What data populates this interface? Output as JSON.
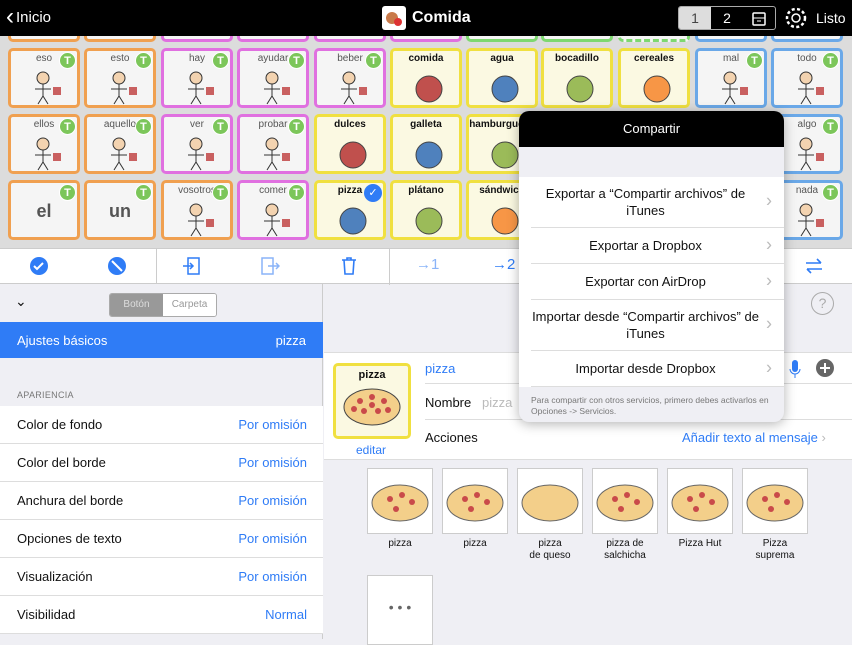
{
  "topbar": {
    "back": "Inicio",
    "title": "Comida",
    "pages": [
      "1",
      "2"
    ],
    "done": "Listo"
  },
  "colors": {
    "orange": "#f0a050",
    "pink": "#e070e0",
    "yellow": "#f0e040",
    "blue": "#6aa8e8",
    "green": "#7ed870",
    "accent": "#2f7cf6"
  },
  "grid": {
    "top_row": [
      "orange",
      "orange",
      "pink",
      "pink",
      "pink",
      "pink",
      "green",
      "green",
      "green",
      "blue",
      "blue"
    ],
    "rows": [
      [
        {
          "label": "eso",
          "c": "orange",
          "t": true,
          "icon": "pointing-icon"
        },
        {
          "label": "esto",
          "c": "orange",
          "t": true,
          "icon": "person-pointing-icon"
        },
        {
          "label": "hay",
          "c": "pink",
          "t": true,
          "icon": "shapes-icon"
        },
        {
          "label": "ayudar",
          "c": "pink",
          "t": true,
          "icon": "helping-icon"
        },
        {
          "label": "beber",
          "c": "pink",
          "t": true,
          "icon": "person-drinking-icon"
        },
        {
          "label": "comida",
          "c": "yellow",
          "food": true,
          "icon": "food-icon"
        },
        {
          "label": "agua",
          "c": "yellow",
          "food": true,
          "icon": "water-bottle-icon"
        },
        {
          "label": "bocadillo",
          "c": "yellow",
          "food": true,
          "icon": "sandwich-icon"
        },
        {
          "label": "cereales",
          "c": "yellow",
          "food": true,
          "icon": "cereal-icon"
        },
        {
          "label": "mal",
          "c": "blue",
          "t": true,
          "icon": "person-sad-icon"
        },
        {
          "label": "todo",
          "c": "blue",
          "t": true,
          "icon": "all-icon"
        }
      ],
      [
        {
          "label": "ellos",
          "c": "orange",
          "t": true,
          "icon": "people-icon"
        },
        {
          "label": "aquello",
          "c": "orange",
          "t": true,
          "icon": "pointing-icon"
        },
        {
          "label": "ver",
          "c": "pink",
          "t": true,
          "icon": "eye-icon"
        },
        {
          "label": "probar",
          "c": "pink",
          "t": true,
          "icon": "person-tasting-icon"
        },
        {
          "label": "dulces",
          "c": "yellow",
          "food": true,
          "icon": "candy-icon"
        },
        {
          "label": "galleta",
          "c": "yellow",
          "food": true,
          "icon": "cookie-icon"
        },
        {
          "label": "hamburguesa",
          "c": "yellow",
          "food": true,
          "icon": "burger-icon"
        },
        {
          "label": "",
          "c": "yellow",
          "food": true,
          "icon": "food-icon"
        },
        {
          "label": "",
          "c": "yellow",
          "food": true,
          "icon": "food-icon"
        },
        {
          "label": "",
          "c": "blue",
          "t": true,
          "icon": "word-icon"
        },
        {
          "label": "algo",
          "c": "blue",
          "t": true,
          "icon": "glass-icon"
        }
      ],
      [
        {
          "label": "",
          "big": "el",
          "c": "orange",
          "t": true
        },
        {
          "label": "",
          "big": "un",
          "c": "orange",
          "t": true
        },
        {
          "label": "vosotros",
          "c": "orange",
          "t": true,
          "icon": "people-icon"
        },
        {
          "label": "comer",
          "c": "pink",
          "t": true,
          "icon": "person-eating-icon"
        },
        {
          "label": "pizza",
          "c": "yellow",
          "food": true,
          "checked": true,
          "icon": "pizza-icon"
        },
        {
          "label": "plátano",
          "c": "yellow",
          "food": true,
          "icon": "banana-icon"
        },
        {
          "label": "sándwich",
          "c": "yellow",
          "food": true,
          "icon": "sandwich-icon"
        },
        {
          "label": "",
          "c": "yellow",
          "food": true,
          "icon": "food-icon"
        },
        {
          "label": "",
          "c": "yellow",
          "food": true,
          "icon": "food-icon"
        },
        {
          "label": "",
          "c": "blue",
          "t": true,
          "icon": "word-icon"
        },
        {
          "label": "nada",
          "c": "blue",
          "t": true,
          "icon": "nothing-icon"
        }
      ]
    ]
  },
  "toolbar": {
    "goto1": "→1",
    "goto2": "→2"
  },
  "left": {
    "seg": [
      "Botón",
      "Carpeta"
    ],
    "basic_label": "Ajustes básicos",
    "basic_value": "pizza",
    "section": "APARIENCIA",
    "rows": [
      {
        "label": "Color de fondo",
        "value": "Por omisión"
      },
      {
        "label": "Color del borde",
        "value": "Por omisión"
      },
      {
        "label": "Anchura del borde",
        "value": "Por omisión"
      },
      {
        "label": "Opciones de texto",
        "value": "Por omisión"
      },
      {
        "label": "Visualización",
        "value": "Por omisión"
      },
      {
        "label": "Visibilidad",
        "value": "Normal"
      }
    ]
  },
  "form": {
    "tile_label": "pizza",
    "edit": "editar",
    "message": "pizza",
    "name_label": "Nombre",
    "name_placeholder": "pizza",
    "actions_label": "Acciones",
    "actions_value": "Añadir texto al mensaje"
  },
  "gallery": [
    {
      "caption": "pizza"
    },
    {
      "caption": "pizza"
    },
    {
      "caption": "pizza\nde queso"
    },
    {
      "caption": "pizza de\nsalchicha"
    },
    {
      "caption": "Pizza Hut"
    },
    {
      "caption": "Pizza\nsuprema"
    }
  ],
  "more": "• • •",
  "popover": {
    "title": "Compartir",
    "items": [
      "Exportar a “Compartir archivos” de iTunes",
      "Exportar a Dropbox",
      "Exportar con AirDrop",
      "Importar desde “Compartir archivos” de iTunes",
      "Importar desde Dropbox"
    ],
    "note": "Para compartir con otros servicios, primero debes activarlos en Opciones -> Servicios."
  }
}
